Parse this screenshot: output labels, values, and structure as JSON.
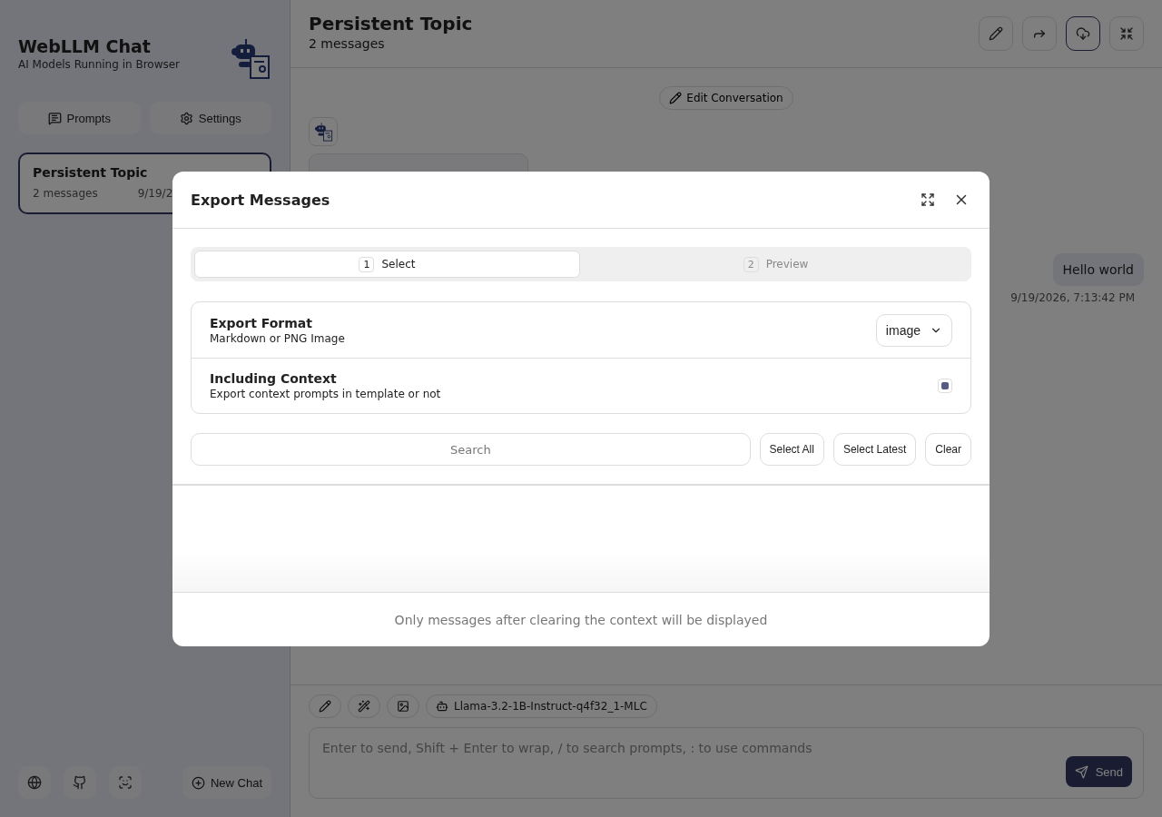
{
  "sidebar": {
    "title": "WebLLM Chat",
    "subtitle": "AI Models Running in Browser",
    "buttons": [
      {
        "kind": "prompts",
        "label": "Prompts"
      },
      {
        "kind": "settings",
        "label": "Settings"
      }
    ],
    "chats": [
      {
        "title": "Persistent Topic",
        "count": "2 messages",
        "date": "9/19/2",
        "selected": true
      }
    ],
    "new_chat": "New Chat"
  },
  "header": {
    "title": "Persistent Topic",
    "subtitle": "2 messages"
  },
  "edit_conversation": "Edit Conversation",
  "messages": [
    {
      "text": "Hello world",
      "date": "9/19/2026, 7:13:42 PM"
    }
  ],
  "composer": {
    "model": "Llama-3.2-1B-Instruct-q4f32_1-MLC",
    "placeholder": "Enter to send, Shift + Enter to wrap, / to search prompts, : to use commands",
    "send": "Send"
  },
  "modal": {
    "title": "Export Messages",
    "steps": [
      {
        "number": "1",
        "label": "Select",
        "selected": true
      },
      {
        "number": "2",
        "label": "Preview",
        "selected": false
      }
    ],
    "options": [
      {
        "kind": "select",
        "title": "Export Format",
        "description": "Markdown or PNG Image",
        "value": "image"
      },
      {
        "kind": "checkbox",
        "title": "Including Context",
        "description": "Export context prompts in template or not",
        "checked": true
      }
    ],
    "search_placeholder": "Search",
    "actions": [
      "Select All",
      "Select Latest",
      "Clear"
    ],
    "footer": "Only messages after clearing the context will be displayed"
  }
}
